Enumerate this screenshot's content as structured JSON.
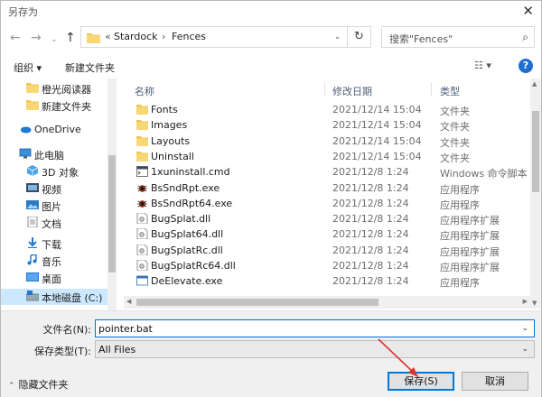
{
  "window": {
    "title": "另存为",
    "close_glyph": "✕"
  },
  "nav": {
    "back_icon": "back-arrow-icon",
    "forward_icon": "forward-arrow-icon",
    "recent_icon": "chevron-down-icon",
    "up_icon": "up-arrow-icon",
    "breadcrumb": [
      "Stardock",
      "Fences"
    ],
    "breadcrumb_prefix": "«",
    "separator": "›",
    "refresh_glyph": "↻",
    "search_placeholder": "搜索\"Fences\""
  },
  "toolbar": {
    "organize_label": "组织 ▾",
    "new_folder_label": "新建文件夹",
    "view_glyph": "☷ ▾",
    "help_glyph": "?"
  },
  "sidebar": {
    "items": [
      {
        "label": "橙光阅读器",
        "icon": "folder-icon"
      },
      {
        "label": "新建文件夹",
        "icon": "folder-icon"
      },
      {
        "label": "OneDrive",
        "icon": "cloud-icon"
      },
      {
        "label": "此电脑",
        "icon": "computer-icon"
      },
      {
        "label": "3D 对象",
        "icon": "cube-icon"
      },
      {
        "label": "视频",
        "icon": "video-icon"
      },
      {
        "label": "图片",
        "icon": "picture-icon"
      },
      {
        "label": "文档",
        "icon": "document-icon"
      },
      {
        "label": "下载",
        "icon": "download-icon"
      },
      {
        "label": "音乐",
        "icon": "music-icon"
      },
      {
        "label": "桌面",
        "icon": "desktop-icon"
      },
      {
        "label": "本地磁盘 (C:)",
        "icon": "drive-icon"
      }
    ]
  },
  "list": {
    "columns": {
      "name": "名称",
      "date": "修改日期",
      "type": "类型"
    },
    "files": [
      {
        "name": "Fonts",
        "date": "2021/12/14 15:04",
        "type": "文件夹",
        "icon": "folder-icon"
      },
      {
        "name": "Images",
        "date": "2021/12/14 15:04",
        "type": "文件夹",
        "icon": "folder-icon"
      },
      {
        "name": "Layouts",
        "date": "2021/12/14 15:04",
        "type": "文件夹",
        "icon": "folder-icon"
      },
      {
        "name": "Uninstall",
        "date": "2021/12/14 15:04",
        "type": "文件夹",
        "icon": "folder-icon"
      },
      {
        "name": "1xuninstall.cmd",
        "date": "2021/12/8 1:24",
        "type": "Windows 命令脚本",
        "icon": "script-icon"
      },
      {
        "name": "BsSndRpt.exe",
        "date": "2021/12/8 1:24",
        "type": "应用程序",
        "icon": "bug-app-icon"
      },
      {
        "name": "BsSndRpt64.exe",
        "date": "2021/12/8 1:24",
        "type": "应用程序",
        "icon": "bug-app-icon"
      },
      {
        "name": "BugSplat.dll",
        "date": "2021/12/8 1:24",
        "type": "应用程序扩展",
        "icon": "dll-icon"
      },
      {
        "name": "BugSplat64.dll",
        "date": "2021/12/8 1:24",
        "type": "应用程序扩展",
        "icon": "dll-icon"
      },
      {
        "name": "BugSplatRc.dll",
        "date": "2021/12/8 1:24",
        "type": "应用程序扩展",
        "icon": "dll-icon"
      },
      {
        "name": "BugSplatRc64.dll",
        "date": "2021/12/8 1:24",
        "type": "应用程序扩展",
        "icon": "dll-icon"
      },
      {
        "name": "DeElevate.exe",
        "date": "2021/12/8 1:24",
        "type": "应用程序",
        "icon": "exe-icon"
      }
    ]
  },
  "form": {
    "filename_label": "文件名(N):",
    "filename_value": "pointer.bat",
    "filetype_label": "保存类型(T):",
    "filetype_value": "All Files",
    "hide_folders_label": "隐藏文件夹",
    "save_label": "保存(S)",
    "cancel_label": "取消"
  },
  "colors": {
    "accent": "#0078d7",
    "selection": "#cce8ff",
    "folder": "#f3c553",
    "annotation_arrow": "#d9342b"
  }
}
